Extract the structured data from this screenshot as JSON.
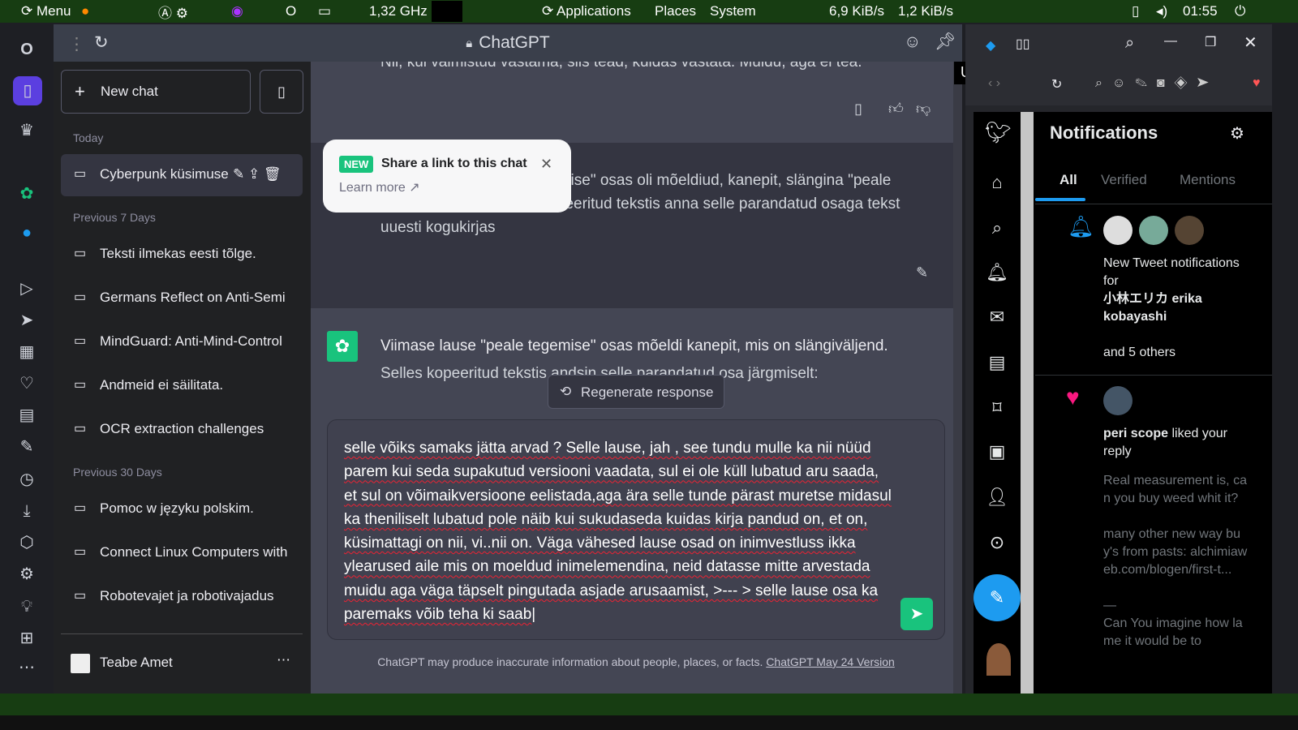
{
  "topbar": {
    "menu": "Menu",
    "cpu": "1,32 GHz",
    "applications": "Applications",
    "places": "Places",
    "system": "System",
    "net_down": "6,9 KiB/s",
    "net_up": "1,2 KiB/s",
    "clock": "01:55"
  },
  "window": {
    "title": "ChatGPT",
    "tooltip": "Unpin"
  },
  "sidebar": {
    "new_chat": "New chat",
    "sections": [
      {
        "label": "Today",
        "items": [
          "Cyberpunk küsimuse"
        ]
      },
      {
        "label": "Previous 7 Days",
        "items": [
          "Teksti ilmekas eesti tõlge.",
          "Germans Reflect on Anti-Semi",
          "MindGuard: Anti-Mind-Control",
          "Andmeid ei säilitata.",
          "OCR extraction challenges"
        ]
      },
      {
        "label": "Previous 30 Days",
        "items": [
          "Pomoc w języku polskim.",
          "Connect Linux Computers with",
          "Robotevajet ja robotivajadus"
        ]
      }
    ],
    "user": "Teabe Amet"
  },
  "popup": {
    "badge": "NEW",
    "title": "Share a link to this chat",
    "link": "Learn more"
  },
  "messages": [
    {
      "role": "assistant",
      "text": "Nii, kui valmistud vastama, siis tead, kuidas vastata. Muidu, aga ei tea."
    },
    {
      "role": "user",
      "text": "Viimase lause \"peale tegemise\" osas oli mõeldiud, kanepit, slängina \"peale tegemise\" osas. Selles kopeeritud tekstis anna selle parandatud osaga tekst uuesti kogukirjas"
    },
    {
      "role": "assistant",
      "line1": "Viimase lause \"peale tegemise\" osas mõeldi kanepit, mis on slängiväljend.",
      "line2": "Selles kopeeritud tekstis andsin selle parandatud osa järgmiselt:"
    }
  ],
  "regenerate": "Regenerate response",
  "composer": {
    "value": "selle võiks samaks jätta arvad ? Selle lause, jah , see tundu mulle ka nii nüüd parem kui seda supakutud versiooni vaadata, sul ei ole küll lubatud aru saada, et sul on võimaikversioone eelistada,aga ära selle tunde pärast muretse midasul ka theniliselt lubatud pole näib kui sukudaseda kuidas kirja pandud on, et on, küsimattagi on nii, vi..nii on. Väga vähesed lause osad on inimvestluss ikka ylearused aile mis on moeldud inimelemendina, neid datasse mitte arvestada muidu aga väga täpselt pingutada asjade arusaamist, >--- > selle lause osa ka paremaks võib teha ki saab"
  },
  "footer": {
    "text": "ChatGPT may produce inaccurate information about people, places, or facts. ",
    "link": "ChatGPT May 24 Version"
  },
  "twitter": {
    "title": "Notifications",
    "tabs": [
      "All",
      "Verified",
      "Mentions"
    ],
    "n1": {
      "line": "New Tweet notifications for",
      "name": "小林エリカ erika kobayashi",
      "others": "and 5 others"
    },
    "n2": {
      "name": "peri scope",
      "action": " liked your reply",
      "body": "Real measurement is, can you buy weed whit it?",
      "body2": "many other new way buy's from pasts: alchimiaweb.com/blogen/first-t...",
      "body3": "Can You imagine how lame it would be to"
    }
  },
  "colors": {
    "accent": "#19c37d",
    "twitter_blue": "#1d9bf0",
    "like": "#f91880"
  }
}
